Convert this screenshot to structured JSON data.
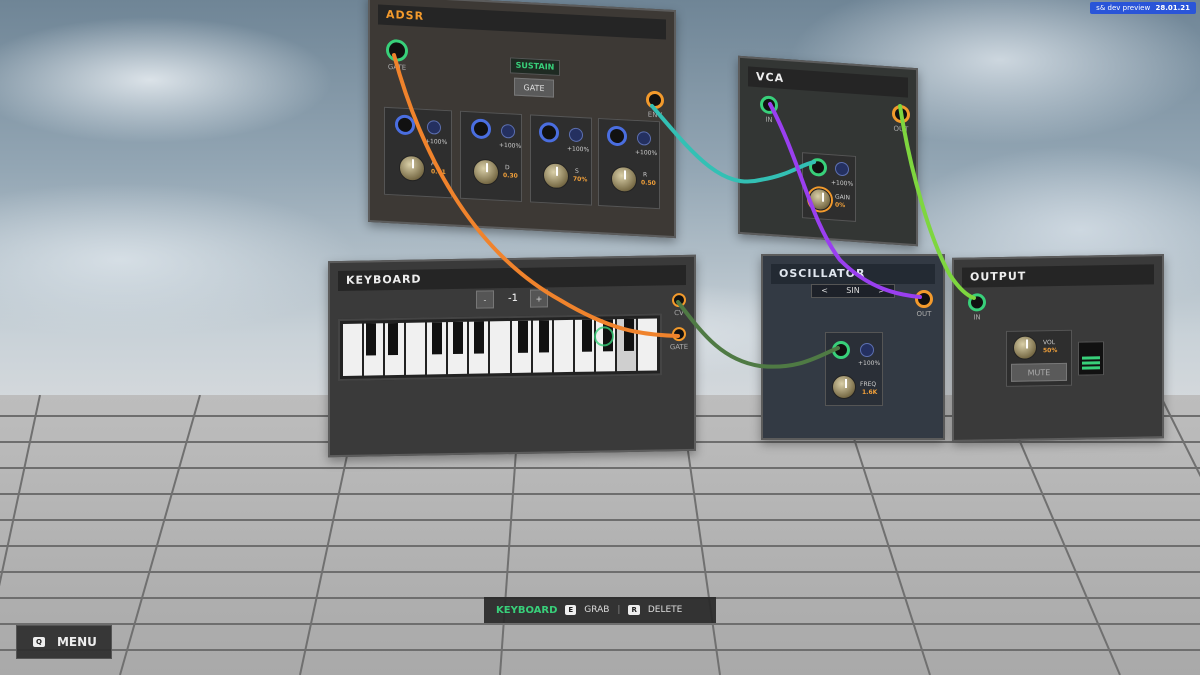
{
  "build": {
    "label": "s& dev preview",
    "date": "28.01.21"
  },
  "adsr": {
    "title": "ADSR",
    "gate_label": "GATE",
    "sustain_label": "SUSTAIN",
    "gate_button": "GATE",
    "env_label": "ENV",
    "stages": [
      {
        "mod": "+100%",
        "name": "A",
        "value": "0.01"
      },
      {
        "mod": "+100%",
        "name": "D",
        "value": "0.30"
      },
      {
        "mod": "+100%",
        "name": "S",
        "value": "70%"
      },
      {
        "mod": "+100%",
        "name": "R",
        "value": "0.50"
      }
    ]
  },
  "vca": {
    "title": "VCA",
    "in_label": "IN",
    "out_label": "OUT",
    "mod": "+100%",
    "gain_label": "GAIN",
    "gain_value": "0%"
  },
  "keyboard": {
    "title": "KEYBOARD",
    "minus": "-",
    "octave": "-1",
    "plus": "+",
    "cv_label": "CV",
    "gate_label": "GATE"
  },
  "oscillator": {
    "title": "OSCILLATOR",
    "prev": "<",
    "wave": "SIN",
    "next": ">",
    "out_label": "OUT",
    "mod": "+100%",
    "freq_label": "FREQ",
    "freq_value": "1.6K"
  },
  "output": {
    "title": "OUTPUT",
    "in_label": "IN",
    "vol_label": "VOL",
    "vol_value": "50%",
    "mute": "MUTE"
  },
  "hud": {
    "selected": "KEYBOARD",
    "grab_key": "E",
    "grab_label": "GRAB",
    "separator": "|",
    "delete_key": "R",
    "delete_label": "DELETE"
  },
  "menu": {
    "key": "Q",
    "label": "MENU"
  },
  "colors": {
    "accent_orange": "#f39a2c",
    "accent_green": "#38d07a",
    "cable_orange": "#f0832c",
    "cable_teal": "#33c0b4",
    "cable_purple": "#9a3ff0",
    "cable_lime": "#7ed63f",
    "cable_olive": "#4f7a44"
  }
}
